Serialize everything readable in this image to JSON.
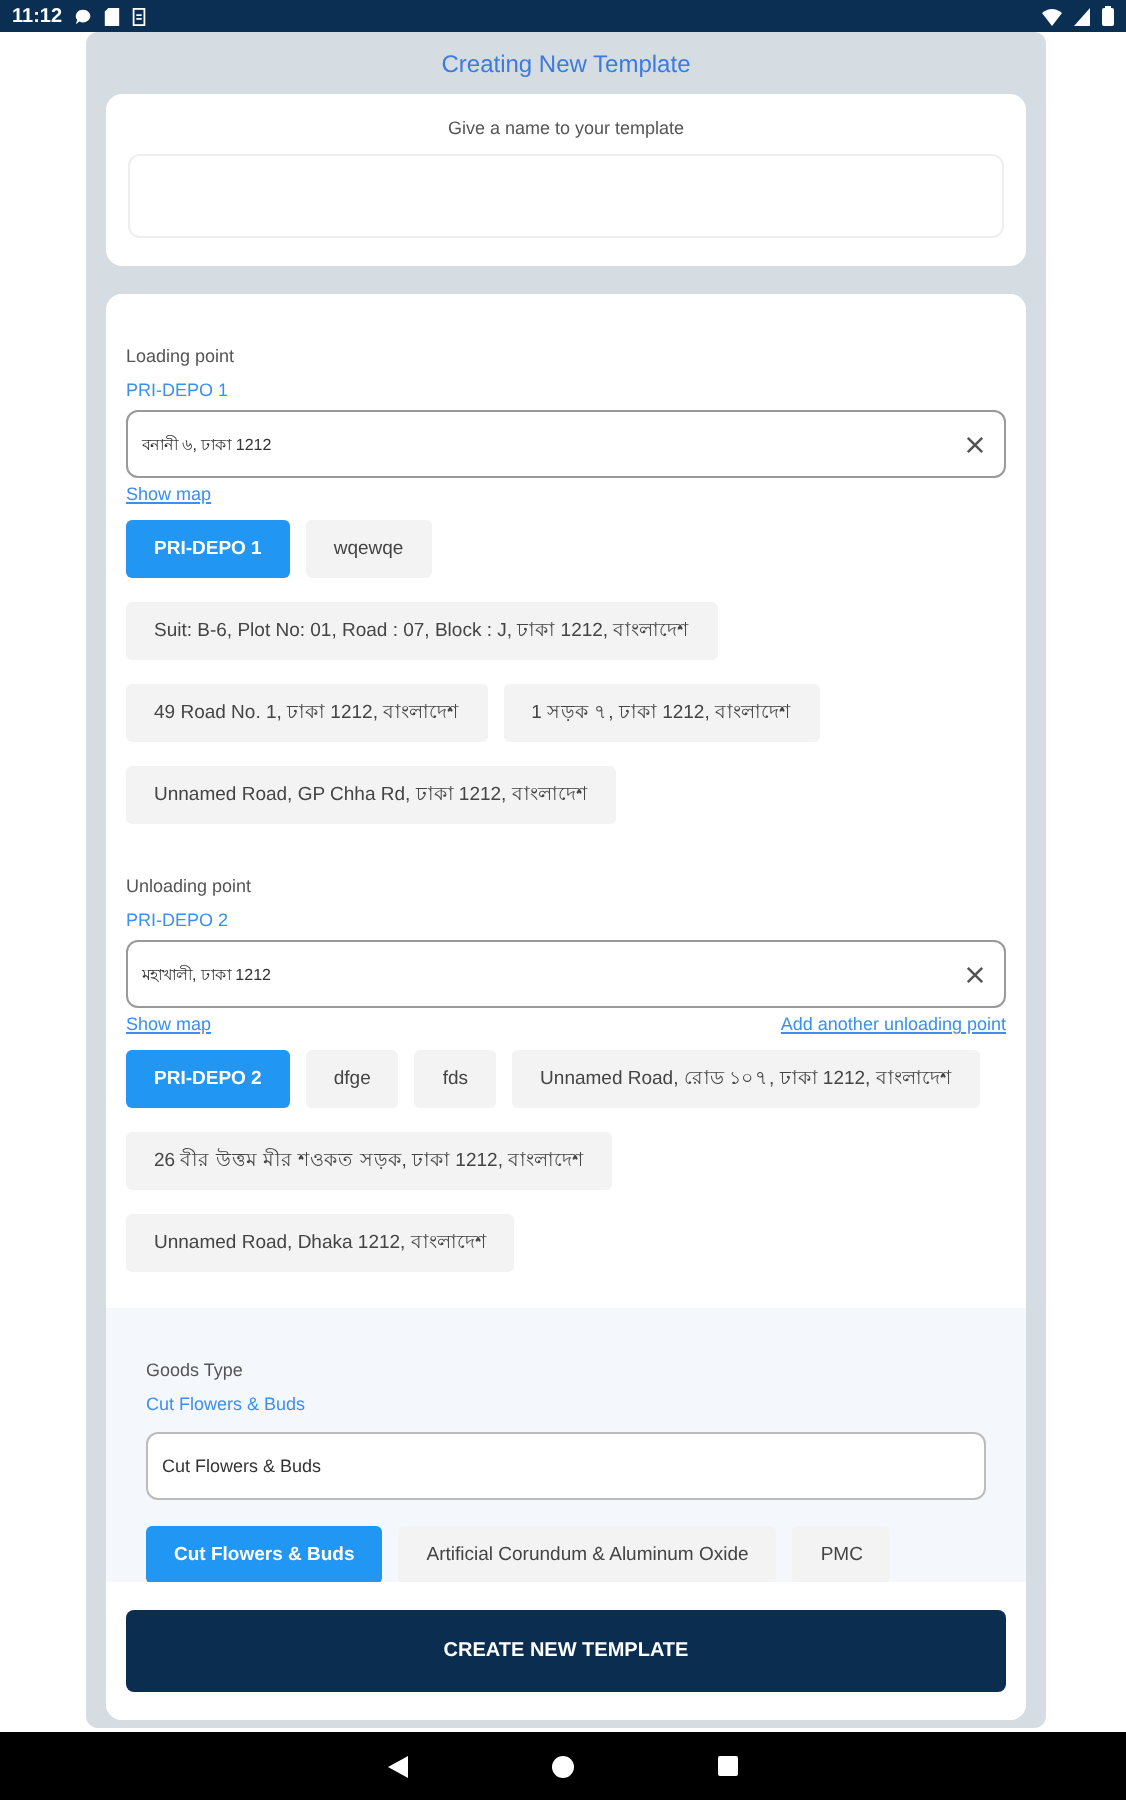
{
  "status_bar": {
    "time": "11:12"
  },
  "title": "Creating New Template",
  "name_card": {
    "label": "Give a name to your template"
  },
  "loading": {
    "label": "Loading point",
    "selected_name": "PRI-DEPO 1",
    "field_value": "বনানী ৬, ঢাকা 1212",
    "show_map": "Show map",
    "chips": [
      {
        "label": "PRI-DEPO 1",
        "selected": true
      },
      {
        "label": "wqewqe",
        "selected": false
      },
      {
        "label": "Suit: B-6, Plot No: 01, Road : 07, Block : J, ঢাকা 1212, বাংলাদেশ",
        "selected": false
      },
      {
        "label": "49 Road No. 1, ঢাকা 1212, বাংলাদেশ",
        "selected": false
      },
      {
        "label": "1 সড়ক ৭, ঢাকা 1212, বাংলাদেশ",
        "selected": false
      },
      {
        "label": "Unnamed Road, GP Chha Rd, ঢাকা 1212, বাংলাদেশ",
        "selected": false
      }
    ]
  },
  "unloading": {
    "label": "Unloading point",
    "selected_name": "PRI-DEPO 2",
    "field_value": "মহাখালী, ঢাকা 1212",
    "show_map": "Show map",
    "add_link": "Add another unloading point",
    "chips": [
      {
        "label": "PRI-DEPO 2",
        "selected": true
      },
      {
        "label": "dfge",
        "selected": false
      },
      {
        "label": "fds",
        "selected": false
      },
      {
        "label": "Unnamed Road, রোড ১০৭, ঢাকা 1212, বাংলাদেশ",
        "selected": false
      },
      {
        "label": "26 বীর উত্তম মীর শওকত সড়ক, ঢাকা 1212, বাংলাদেশ",
        "selected": false
      },
      {
        "label": "Unnamed Road, Dhaka 1212, বাংলাদেশ",
        "selected": false
      }
    ]
  },
  "goods": {
    "label": "Goods Type",
    "selected_name": "Cut Flowers & Buds",
    "field_value": "Cut Flowers & Buds",
    "chips": [
      {
        "label": "Cut Flowers & Buds",
        "selected": true
      },
      {
        "label": "Artificial Corundum & Aluminum Oxide",
        "selected": false
      },
      {
        "label": "PMC",
        "selected": false
      }
    ]
  },
  "submit": "CREATE NEW TEMPLATE"
}
